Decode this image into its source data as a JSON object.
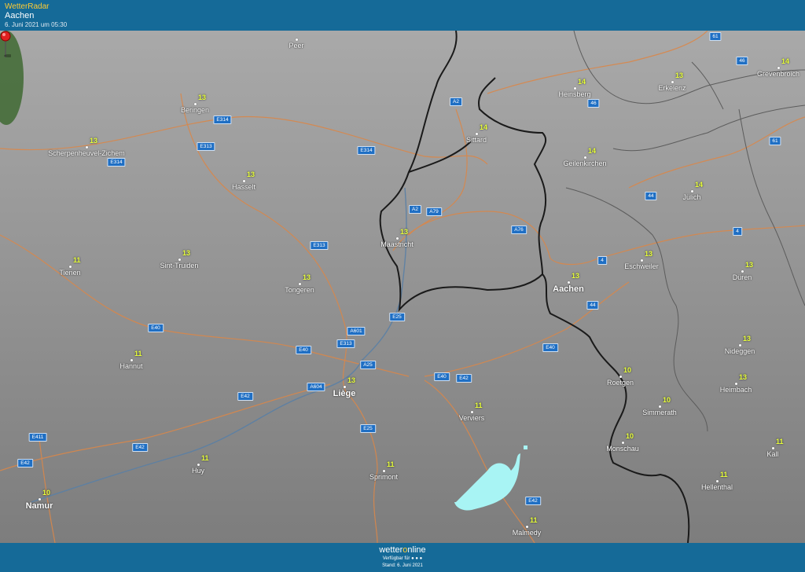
{
  "header": {
    "app_name": "WetterRadar",
    "location": "Aachen",
    "timestamp": "6. Juni 2021 um 05:30"
  },
  "footer": {
    "brand_prefix": "wetter",
    "brand_o": "o",
    "brand_suffix": "nline",
    "availability": "Verfügbar für ● ● ●",
    "stand": "Stand: 6. Juni 2021"
  },
  "colors": {
    "header_bg": "#156a98",
    "road": "#d9874a",
    "border": "#1a1a1a",
    "temperature": "#e8ff3a",
    "precipitation": "#a8f4f4",
    "pin": "#e02020"
  },
  "icons": [
    "location-pin-icon"
  ],
  "cities": [
    {
      "name": "Peer",
      "temp": ""
    },
    {
      "name": "Beringen",
      "temp": "13"
    },
    {
      "name": "Scherpenheuvel-Zichem",
      "temp": "13"
    },
    {
      "name": "Hasselt",
      "temp": "13"
    },
    {
      "name": "Tienen",
      "temp": "11"
    },
    {
      "name": "Sint-Truiden",
      "temp": "13"
    },
    {
      "name": "Tongeren",
      "temp": "13"
    },
    {
      "name": "Hannut",
      "temp": "11"
    },
    {
      "name": "Liège",
      "temp": "13"
    },
    {
      "name": "Huy",
      "temp": "11"
    },
    {
      "name": "Namur",
      "temp": "10"
    },
    {
      "name": "Maastricht",
      "temp": "13"
    },
    {
      "name": "Sittard",
      "temp": "14"
    },
    {
      "name": "Heinsberg",
      "temp": "14"
    },
    {
      "name": "Erkelenz",
      "temp": "13"
    },
    {
      "name": "Grevenbroich",
      "temp": "14"
    },
    {
      "name": "Geilenkirchen",
      "temp": "14"
    },
    {
      "name": "Jülich",
      "temp": "14"
    },
    {
      "name": "Aachen",
      "temp": "13"
    },
    {
      "name": "Eschweiler",
      "temp": "13"
    },
    {
      "name": "Düren",
      "temp": "13"
    },
    {
      "name": "Nideggen",
      "temp": "13"
    },
    {
      "name": "Heimbach",
      "temp": "13"
    },
    {
      "name": "Roetgen",
      "temp": "10"
    },
    {
      "name": "Simmerath",
      "temp": "10"
    },
    {
      "name": "Monschau",
      "temp": "10"
    },
    {
      "name": "Verviers",
      "temp": "11"
    },
    {
      "name": "Sprimont",
      "temp": "11"
    },
    {
      "name": "Malmedy",
      "temp": "11"
    },
    {
      "name": "Hellenthal",
      "temp": "11"
    },
    {
      "name": "Kall",
      "temp": "11"
    }
  ],
  "roads": [
    "E314",
    "E313",
    "E314",
    "E314",
    "E313",
    "E40",
    "E40",
    "E313",
    "A601",
    "A25",
    "A604",
    "E42",
    "E42",
    "E42",
    "E411",
    "E25",
    "E40",
    "E42",
    "E25",
    "E40",
    "E42",
    "A2",
    "A2",
    "A79",
    "A76",
    "4",
    "44",
    "61",
    "46",
    "46",
    "44",
    "4",
    "61"
  ]
}
